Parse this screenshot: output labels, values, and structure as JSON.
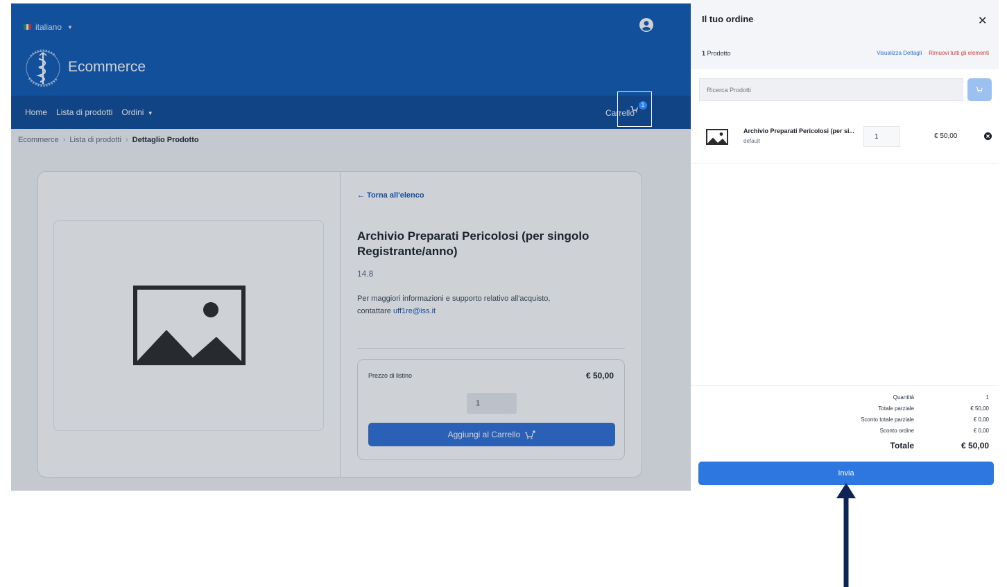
{
  "header": {
    "language": "italiano",
    "brand": "Ecommerce",
    "colors": {
      "topbar": "#0f5ab7",
      "navbar": "#0c4b99",
      "accent": "#2d6fd6"
    }
  },
  "nav": {
    "items": [
      "Home",
      "Lista di prodotti",
      "Ordini"
    ],
    "cart_label": "Carrello",
    "cart_badge": "1"
  },
  "breadcrumb": [
    "Ecommerce",
    "Lista di prodotti",
    "Dettaglio Prodotto"
  ],
  "product": {
    "back_link": "← Torna all'elenco",
    "title": "Archivio Preparati Pericolosi (per singolo Registrante/anno)",
    "code": "14.8",
    "info_text": "Per maggiori informazioni e supporto relativo all'acquisto, contattare",
    "info_email": "uff1re@iss.it",
    "price_label": "Prezzo di listino",
    "price": "€ 50,00",
    "quantity": "1",
    "add_to_cart": "Aggiungi al Carrello"
  },
  "cart_panel": {
    "title": "Il tuo ordine",
    "count_number": "1",
    "count_label": "Prodotto",
    "view_details": "Visualizza Dettagli",
    "remove_all": "Rimuovi tutti gli elementi",
    "search_placeholder": "Ricerca Prodotti",
    "items": [
      {
        "name": "Archivio Preparati Pericolosi (per si...",
        "variant": "default",
        "quantity": "1",
        "price": "€ 50,00"
      }
    ],
    "totals": {
      "quantity_label": "Quantità",
      "quantity_value": "1",
      "subtotal_label": "Totale parziale",
      "subtotal_value": "€ 50,00",
      "subtotal_discount_label": "Sconto totale parziale",
      "subtotal_discount_value": "€ 0,00",
      "order_discount_label": "Sconto ordine",
      "order_discount_value": "€ 0,00",
      "total_label": "Totale",
      "total_value": "€ 50,00"
    },
    "submit": "Invia"
  }
}
